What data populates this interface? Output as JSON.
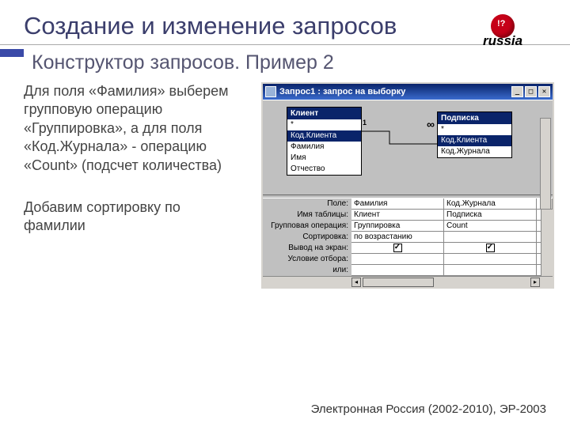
{
  "slide": {
    "title": "Создание и изменение запросов",
    "subtitle": "Конструктор запросов. Пример 2",
    "para1": "Для поля «Фамилия» выберем групповую операцию «Группировка», а для поля «Код.Журнала» - операцию «Count» (подсчет количества)",
    "para2": "Добавим сортировку по фамилии",
    "footer": "Электронная Россия (2002-2010), ЭР-2003",
    "logo_text": "russia"
  },
  "window": {
    "title": "Запрос1 : запрос на выборку",
    "btn_min": "_",
    "btn_max": "□",
    "btn_close": "✕",
    "table1": {
      "name": "Клиент",
      "fields": [
        "*",
        "Код.Клиента",
        "Фамилия",
        "Имя",
        "Отчество"
      ]
    },
    "table2": {
      "name": "Подписка",
      "fields": [
        "*",
        "Код.Клиента",
        "Код.Журнала"
      ]
    },
    "join": {
      "left": "1",
      "right": "∞"
    },
    "labels": {
      "field": "Поле:",
      "table": "Имя таблицы:",
      "group": "Групповая операция:",
      "sort": "Сортировка:",
      "show": "Вывод на экран:",
      "crit": "Условие отбора:",
      "or": "или:"
    },
    "col1": {
      "field": "Фамилия",
      "table": "Клиент",
      "group": "Группировка",
      "sort": "по возрастанию",
      "show": true
    },
    "col2": {
      "field": "Код.Журнала",
      "table": "Подписка",
      "group": "Count",
      "sort": "",
      "show": true
    }
  }
}
